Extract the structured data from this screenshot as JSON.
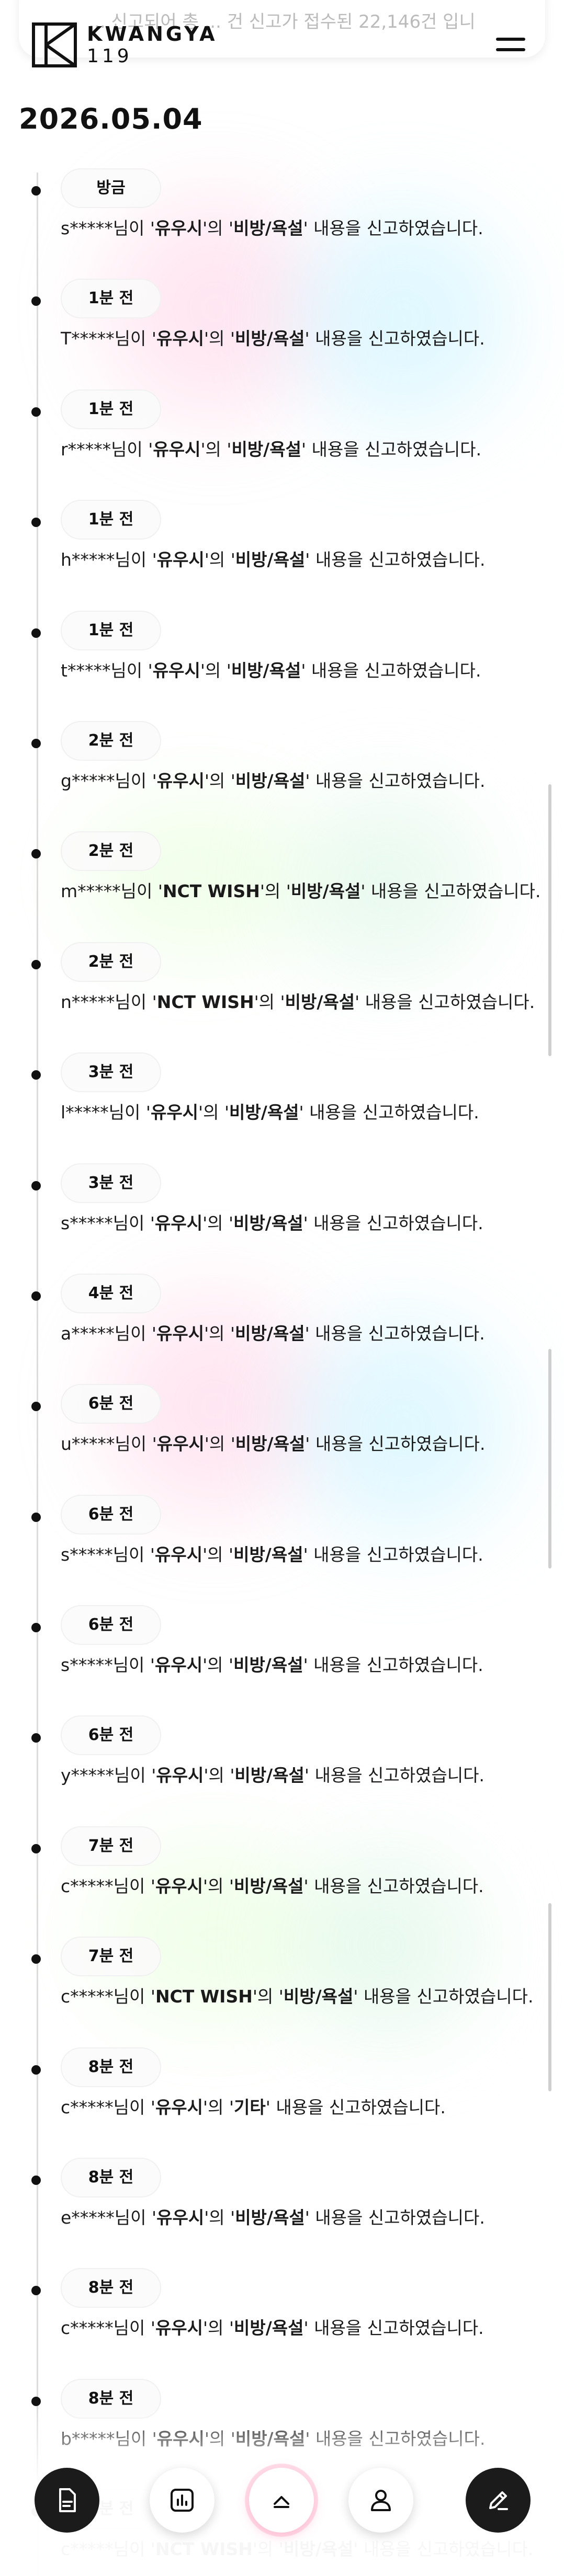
{
  "top_card": {
    "partial_text": "... 신고되어 총 ... 건 신고가 접수된 22,146건 입니"
  },
  "header": {
    "logo_text": "KWANGYA",
    "logo_sub": "119",
    "menu_icon": "hamburger-icon"
  },
  "date": "2026.05.04",
  "entries": [
    {
      "time": "방금",
      "user": "s*****님이 '",
      "artist": "유우시",
      "mid": "'의 '",
      "category": "비방/욕설",
      "tail": "' 내용을 신고하였습니다."
    },
    {
      "time": "1분 전",
      "user": "T*****님이 '",
      "artist": "유우시",
      "mid": "'의 '",
      "category": "비방/욕설",
      "tail": "' 내용을 신고하였습니다."
    },
    {
      "time": "1분 전",
      "user": "r*****님이 '",
      "artist": "유우시",
      "mid": "'의 '",
      "category": "비방/욕설",
      "tail": "' 내용을 신고하였습니다."
    },
    {
      "time": "1분 전",
      "user": "h*****님이 '",
      "artist": "유우시",
      "mid": "'의 '",
      "category": "비방/욕설",
      "tail": "' 내용을 신고하였습니다."
    },
    {
      "time": "1분 전",
      "user": "t*****님이 '",
      "artist": "유우시",
      "mid": "'의 '",
      "category": "비방/욕설",
      "tail": "' 내용을 신고하였습니다."
    },
    {
      "time": "2분 전",
      "user": "g*****님이 '",
      "artist": "유우시",
      "mid": "'의 '",
      "category": "비방/욕설",
      "tail": "' 내용을 신고하였습니다."
    },
    {
      "time": "2분 전",
      "user": "m*****님이 '",
      "artist": "NCT WISH",
      "mid": "'의 '",
      "category": "비방/욕설",
      "tail": "' 내용을 신고하였습니다."
    },
    {
      "time": "2분 전",
      "user": "n*****님이 '",
      "artist": "NCT WISH",
      "mid": "'의 '",
      "category": "비방/욕설",
      "tail": "' 내용을 신고하였습니다."
    },
    {
      "time": "3분 전",
      "user": "l*****님이 '",
      "artist": "유우시",
      "mid": "'의 '",
      "category": "비방/욕설",
      "tail": "' 내용을 신고하였습니다."
    },
    {
      "time": "3분 전",
      "user": "s*****님이 '",
      "artist": "유우시",
      "mid": "'의 '",
      "category": "비방/욕설",
      "tail": "' 내용을 신고하였습니다."
    },
    {
      "time": "4분 전",
      "user": "a*****님이 '",
      "artist": "유우시",
      "mid": "'의 '",
      "category": "비방/욕설",
      "tail": "' 내용을 신고하였습니다."
    },
    {
      "time": "6분 전",
      "user": "u*****님이 '",
      "artist": "유우시",
      "mid": "'의 '",
      "category": "비방/욕설",
      "tail": "' 내용을 신고하였습니다."
    },
    {
      "time": "6분 전",
      "user": "s*****님이 '",
      "artist": "유우시",
      "mid": "'의 '",
      "category": "비방/욕설",
      "tail": "' 내용을 신고하였습니다."
    },
    {
      "time": "6분 전",
      "user": "s*****님이 '",
      "artist": "유우시",
      "mid": "'의 '",
      "category": "비방/욕설",
      "tail": "' 내용을 신고하였습니다."
    },
    {
      "time": "6분 전",
      "user": "y*****님이 '",
      "artist": "유우시",
      "mid": "'의 '",
      "category": "비방/욕설",
      "tail": "' 내용을 신고하였습니다."
    },
    {
      "time": "7분 전",
      "user": "c*****님이 '",
      "artist": "유우시",
      "mid": "'의 '",
      "category": "비방/욕설",
      "tail": "' 내용을 신고하였습니다."
    },
    {
      "time": "7분 전",
      "user": "c*****님이 '",
      "artist": "NCT WISH",
      "mid": "'의 '",
      "category": "비방/욕설",
      "tail": "' 내용을 신고하였습니다."
    },
    {
      "time": "8분 전",
      "user": "c*****님이 '",
      "artist": "유우시",
      "mid": "'의 '",
      "category": "기타",
      "tail": "' 내용을 신고하였습니다."
    },
    {
      "time": "8분 전",
      "user": "e*****님이 '",
      "artist": "유우시",
      "mid": "'의 '",
      "category": "비방/욕설",
      "tail": "' 내용을 신고하였습니다."
    },
    {
      "time": "8분 전",
      "user": "c*****님이 '",
      "artist": "유우시",
      "mid": "'의 '",
      "category": "비방/욕설",
      "tail": "' 내용을 신고하였습니다."
    },
    {
      "time": "8분 전",
      "user": "b*****님이 '",
      "artist": "유우시",
      "mid": "'의 '",
      "category": "비방/욕설",
      "tail": "' 내용을 신고하였습니다."
    },
    {
      "time": "8분 전",
      "user": "c*****님이 '",
      "artist": "NCT WISH",
      "mid": "'의 '",
      "category": "비방/욕설",
      "tail": "' 내용을 신고하였습니다."
    }
  ],
  "bottom_nav": {
    "items": [
      {
        "icon": "report-document-icon",
        "style": "dark"
      },
      {
        "icon": "bar-chart-icon",
        "style": "light"
      },
      {
        "icon": "chevron-up-icon",
        "style": "accent"
      },
      {
        "icon": "user-icon",
        "style": "light"
      },
      {
        "icon": "edit-pen-icon",
        "style": "dark"
      }
    ]
  },
  "colors": {
    "text": "#111111",
    "timeline_line": "#dcdcdc",
    "accent_pink": "#ff7aa8",
    "nav_dark": "#1b1b1b"
  }
}
